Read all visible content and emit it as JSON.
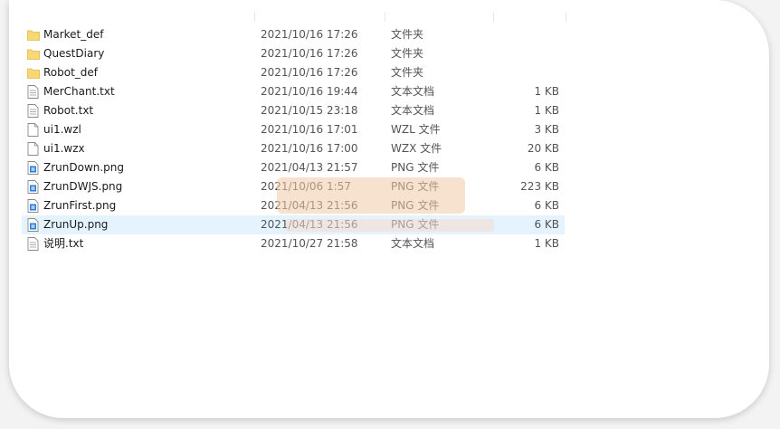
{
  "files": [
    {
      "name": "Market_def",
      "date": "2021/10/16 17:26",
      "type": "文件夹",
      "size": "",
      "icon": "folder-icon"
    },
    {
      "name": "QuestDiary",
      "date": "2021/10/16 17:26",
      "type": "文件夹",
      "size": "",
      "icon": "folder-icon"
    },
    {
      "name": "Robot_def",
      "date": "2021/10/16 17:26",
      "type": "文件夹",
      "size": "",
      "icon": "folder-icon"
    },
    {
      "name": "MerChant.txt",
      "date": "2021/10/16 19:44",
      "type": "文本文档",
      "size": "1 KB",
      "icon": "text-file-icon"
    },
    {
      "name": "Robot.txt",
      "date": "2021/10/15 23:18",
      "type": "文本文档",
      "size": "1 KB",
      "icon": "text-file-icon"
    },
    {
      "name": "ui1.wzl",
      "date": "2021/10/16 17:01",
      "type": "WZL 文件",
      "size": "3 KB",
      "icon": "blank-file-icon"
    },
    {
      "name": "ui1.wzx",
      "date": "2021/10/16 17:00",
      "type": "WZX 文件",
      "size": "20 KB",
      "icon": "blank-file-icon"
    },
    {
      "name": "ZrunDown.png",
      "date": "2021/04/13 21:57",
      "type": "PNG 文件",
      "size": "6 KB",
      "icon": "image-file-icon"
    },
    {
      "name": "ZrunDWJS.png",
      "date": "2021/10/06 1:57",
      "type": "PNG 文件",
      "size": "223 KB",
      "icon": "image-file-icon"
    },
    {
      "name": "ZrunFirst.png",
      "date": "2021/04/13 21:56",
      "type": "PNG 文件",
      "size": "6 KB",
      "icon": "image-file-icon"
    },
    {
      "name": "ZrunUp.png",
      "date": "2021/04/13 21:56",
      "type": "PNG 文件",
      "size": "6 KB",
      "icon": "image-file-icon",
      "selected": true
    },
    {
      "name": "说明.txt",
      "date": "2021/10/27 21:58",
      "type": "文本文档",
      "size": "1 KB",
      "icon": "text-file-icon"
    }
  ],
  "colors": {
    "folder": "#f8d775",
    "selection": "#e5f3ff",
    "image_accent": "#2f7bd6"
  }
}
